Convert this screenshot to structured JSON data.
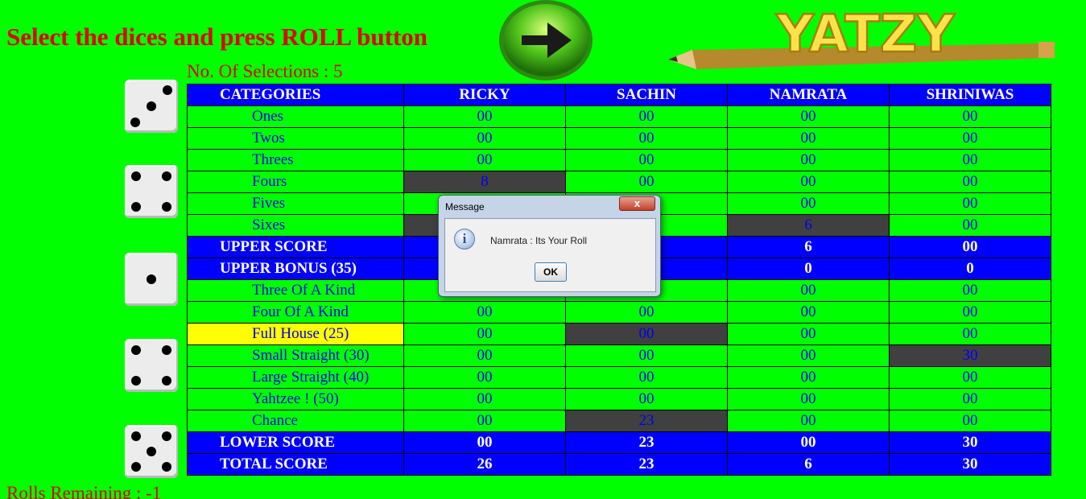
{
  "instruction": "Select the dices and press ROLL button",
  "selections_text": "No. Of Selections : 5",
  "rolls_text": "Rolls Remaining : -1",
  "logo_text": "YATZY",
  "roll_button": {
    "icon": "arrow-right-icon"
  },
  "dice": [
    3,
    4,
    1,
    4,
    5
  ],
  "table": {
    "header": [
      "CATEGORIES",
      "RICKY",
      "SACHIN",
      "NAMRATA",
      "SHRINIWAS"
    ],
    "upper_rows": [
      {
        "label": "Ones",
        "values": [
          "00",
          "00",
          "00",
          "00"
        ]
      },
      {
        "label": "Twos",
        "values": [
          "00",
          "00",
          "00",
          "00"
        ]
      },
      {
        "label": "Threes",
        "values": [
          "00",
          "00",
          "00",
          "00"
        ]
      },
      {
        "label": "Fours",
        "values": [
          "8",
          "00",
          "00",
          "00"
        ]
      },
      {
        "label": "Fives",
        "values": [
          "",
          "",
          "00",
          "00"
        ]
      },
      {
        "label": "Sixes",
        "values": [
          "",
          "",
          "6",
          "00"
        ]
      }
    ],
    "upper_score": {
      "label": "UPPER SCORE",
      "values": [
        "",
        "",
        "6",
        "00"
      ]
    },
    "upper_bonus": {
      "label": "UPPER BONUS  (35)",
      "values": [
        "",
        "",
        "0",
        "0"
      ]
    },
    "lower_rows": [
      {
        "label": "Three Of A Kind",
        "values": [
          "",
          "",
          "00",
          "00"
        ]
      },
      {
        "label": "Four Of A Kind",
        "values": [
          "00",
          "00",
          "00",
          "00"
        ]
      },
      {
        "label": "Full House  (25)",
        "values": [
          "00",
          "00",
          "00",
          "00"
        ]
      },
      {
        "label": "Small Straight (30)",
        "values": [
          "00",
          "00",
          "00",
          "30"
        ]
      },
      {
        "label": "Large Straight (40)",
        "values": [
          "00",
          "00",
          "00",
          "00"
        ]
      },
      {
        "label": "Yahtzee !   (50)",
        "values": [
          "00",
          "00",
          "00",
          "00"
        ]
      },
      {
        "label": "Chance",
        "values": [
          "00",
          "23",
          "00",
          "00"
        ]
      }
    ],
    "lower_score": {
      "label": "LOWER SCORE",
      "values": [
        "00",
        "23",
        "00",
        "30"
      ]
    },
    "total_score": {
      "label": "TOTAL SCORE",
      "values": [
        "26",
        "23",
        "6",
        "30"
      ]
    }
  },
  "dialog": {
    "title": "Message",
    "close_label": "x",
    "message": "Namrata : Its Your Roll",
    "ok_label": "OK",
    "icon": "info-icon"
  },
  "colors": {
    "background": "#00ff00",
    "header_blue": "#0000ff",
    "used_cell": "#404040",
    "selected_category": "#ffff00",
    "text_red": "#e00000"
  }
}
